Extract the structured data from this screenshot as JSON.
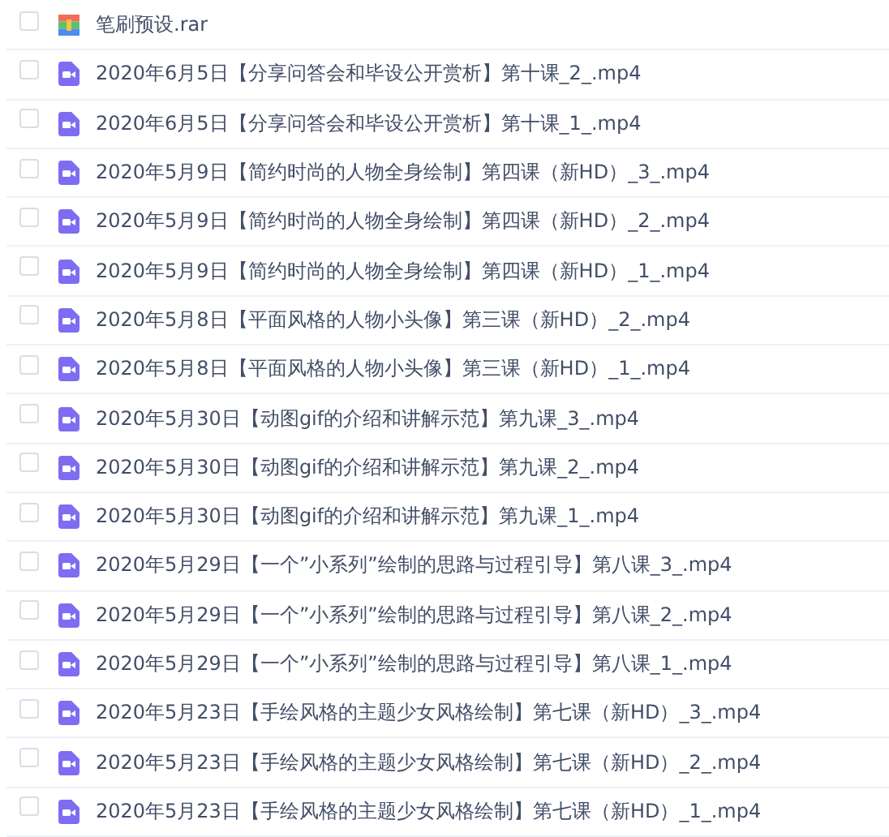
{
  "files": [
    {
      "kind": "archive",
      "name": "笔刷预设.rar",
      "checked": false
    },
    {
      "kind": "video",
      "name": "2020年6月5日【分享问答会和毕设公开赏析】第十课_2_.mp4",
      "checked": false
    },
    {
      "kind": "video",
      "name": "2020年6月5日【分享问答会和毕设公开赏析】第十课_1_.mp4",
      "checked": false
    },
    {
      "kind": "video",
      "name": "2020年5月9日【简约时尚的人物全身绘制】第四课（新HD）_3_.mp4",
      "checked": false
    },
    {
      "kind": "video",
      "name": "2020年5月9日【简约时尚的人物全身绘制】第四课（新HD）_2_.mp4",
      "checked": false
    },
    {
      "kind": "video",
      "name": "2020年5月9日【简约时尚的人物全身绘制】第四课（新HD）_1_.mp4",
      "checked": false
    },
    {
      "kind": "video",
      "name": "2020年5月8日【平面风格的人物小头像】第三课（新HD）_2_.mp4",
      "checked": false
    },
    {
      "kind": "video",
      "name": "2020年5月8日【平面风格的人物小头像】第三课（新HD）_1_.mp4",
      "checked": false
    },
    {
      "kind": "video",
      "name": "2020年5月30日【动图gif的介绍和讲解示范】第九课_3_.mp4",
      "checked": false
    },
    {
      "kind": "video",
      "name": "2020年5月30日【动图gif的介绍和讲解示范】第九课_2_.mp4",
      "checked": false
    },
    {
      "kind": "video",
      "name": "2020年5月30日【动图gif的介绍和讲解示范】第九课_1_.mp4",
      "checked": false
    },
    {
      "kind": "video",
      "name": "2020年5月29日【一个”小系列”绘制的思路与过程引导】第八课_3_.mp4",
      "checked": false
    },
    {
      "kind": "video",
      "name": "2020年5月29日【一个”小系列”绘制的思路与过程引导】第八课_2_.mp4",
      "checked": false
    },
    {
      "kind": "video",
      "name": "2020年5月29日【一个”小系列”绘制的思路与过程引导】第八课_1_.mp4",
      "checked": false
    },
    {
      "kind": "video",
      "name": "2020年5月23日【手绘风格的主题少女风格绘制】第七课（新HD）_3_.mp4",
      "checked": false
    },
    {
      "kind": "video",
      "name": "2020年5月23日【手绘风格的主题少女风格绘制】第七课（新HD）_2_.mp4",
      "checked": false
    },
    {
      "kind": "video",
      "name": "2020年5月23日【手绘风格的主题少女风格绘制】第七课（新HD）_1_.mp4",
      "checked": false
    }
  ]
}
